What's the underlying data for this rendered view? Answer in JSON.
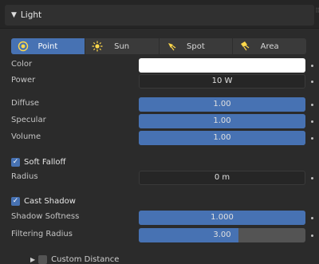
{
  "panel": {
    "title": "Light"
  },
  "light_types": [
    {
      "label": "Point",
      "icon": "point-light-icon",
      "active": true
    },
    {
      "label": "Sun",
      "icon": "sun-light-icon",
      "active": false
    },
    {
      "label": "Spot",
      "icon": "spot-light-icon",
      "active": false
    },
    {
      "label": "Area",
      "icon": "area-light-icon",
      "active": false
    }
  ],
  "properties": {
    "color": {
      "label": "Color",
      "value_hex": "#ffffff"
    },
    "power": {
      "label": "Power",
      "value": "10 W"
    },
    "diffuse": {
      "label": "Diffuse",
      "value": "1.00",
      "fill": 1.0
    },
    "specular": {
      "label": "Specular",
      "value": "1.00",
      "fill": 1.0
    },
    "volume": {
      "label": "Volume",
      "value": "1.00",
      "fill": 1.0
    },
    "soft_falloff": {
      "label": "Soft Falloff",
      "checked": true
    },
    "radius": {
      "label": "Radius",
      "value": "0 m"
    },
    "cast_shadow": {
      "label": "Cast Shadow",
      "checked": true
    },
    "shadow_softness": {
      "label": "Shadow Softness",
      "value": "1.000",
      "fill": 1.0
    },
    "filtering_radius": {
      "label": "Filtering Radius",
      "value": "3.00",
      "fill": 0.6
    },
    "custom_distance": {
      "label": "Custom Distance",
      "checked": false,
      "expanded": false
    }
  },
  "colors": {
    "accent": "#4772b3",
    "background": "#2b2b2b",
    "field": "#545454"
  }
}
